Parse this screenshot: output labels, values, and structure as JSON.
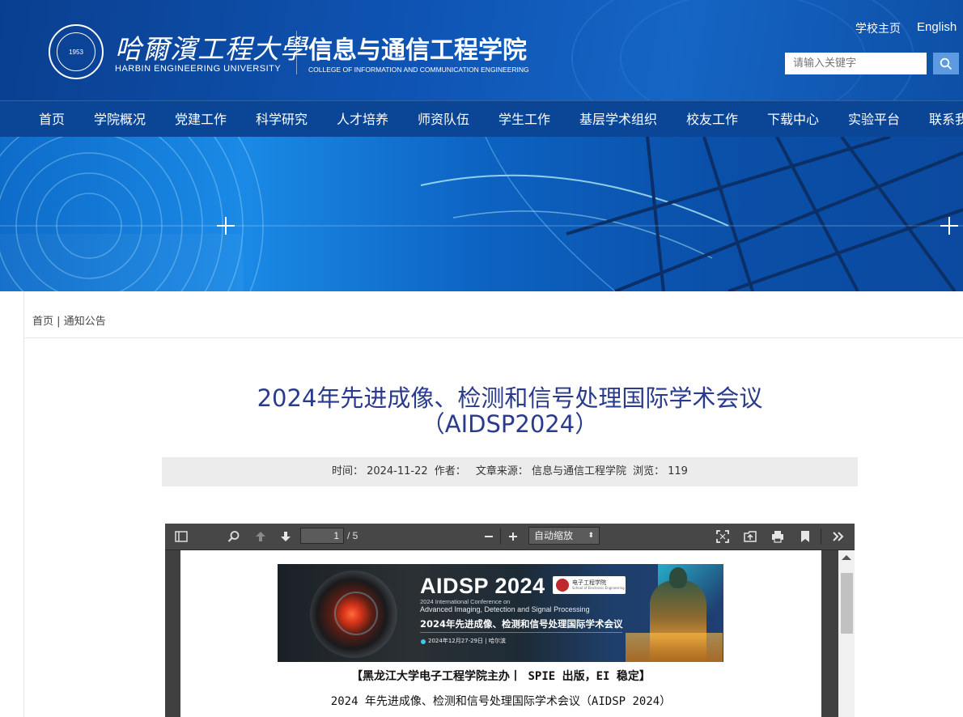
{
  "header": {
    "university_cn": "哈爾濱工程大學",
    "university_en": "HARBIN ENGINEERING UNIVERSITY",
    "logo_year": "1953",
    "college_cn": "信息与通信工程学院",
    "college_en": "COLLEGE OF INFORMATION AND COMMUNICATION ENGINEERING",
    "links": {
      "home": "学校主页",
      "english": "English"
    },
    "search": {
      "placeholder": "请输入关键字",
      "icon": "search-icon"
    }
  },
  "nav": {
    "items": [
      "首页",
      "学院概况",
      "党建工作",
      "科学研究",
      "人才培养",
      "师资队伍",
      "学生工作",
      "基层学术组织",
      "校友工作",
      "下载中心",
      "实验平台",
      "联系我"
    ]
  },
  "breadcrumb": {
    "home": "首页",
    "separator": "|",
    "current": "通知公告"
  },
  "article": {
    "title_line1": "2024年先进成像、检测和信号处理国际学术会议",
    "title_line2": "（AIDSP2024）",
    "meta": {
      "time_label": "时间：",
      "time": "2024-11-22",
      "author_label": "作者：",
      "author": "",
      "source_label": "文章来源：",
      "source": "信息与通信工程学院",
      "views_label": "浏览：",
      "views": "119"
    }
  },
  "pdf_viewer": {
    "current_page": "1",
    "total_pages": "/ 5",
    "zoom": "自动缩放",
    "toolbar_icons": [
      "sidebar-toggle-icon",
      "find-icon",
      "previous-page-icon",
      "next-page-icon",
      "zoom-out-icon",
      "zoom-in-icon",
      "presentation-mode-icon",
      "open-file-icon",
      "print-icon",
      "bookmark-icon",
      "tools-icon"
    ],
    "scroll_position": 0.0
  },
  "pdf_content": {
    "poster": {
      "title": "AIDSP 2024",
      "badge_cn": "电子工程学院",
      "badge_en": "School of Electronic Engineering",
      "en_line1": "2024 International Conference on",
      "en_line2": "Advanced Imaging, Detection and Signal Processing",
      "cn_title": "2024年先进成像、检测和信号处理国际学术会议",
      "date": "2024年12月27-29日 | 哈尔滨"
    },
    "line1": "【黑龙江大学电子工程学院主办丨 SPIE 出版，EI 稳定】",
    "line2": "2024 年先进成像、检测和信号处理国际学术会议（AIDSP 2024）"
  },
  "colors": {
    "header_blue": "#0f55b5",
    "nav_blue": "#0a4596",
    "title_color": "#2a3a8c",
    "meta_bg": "#ececec",
    "search_button": "#5c9be0"
  }
}
